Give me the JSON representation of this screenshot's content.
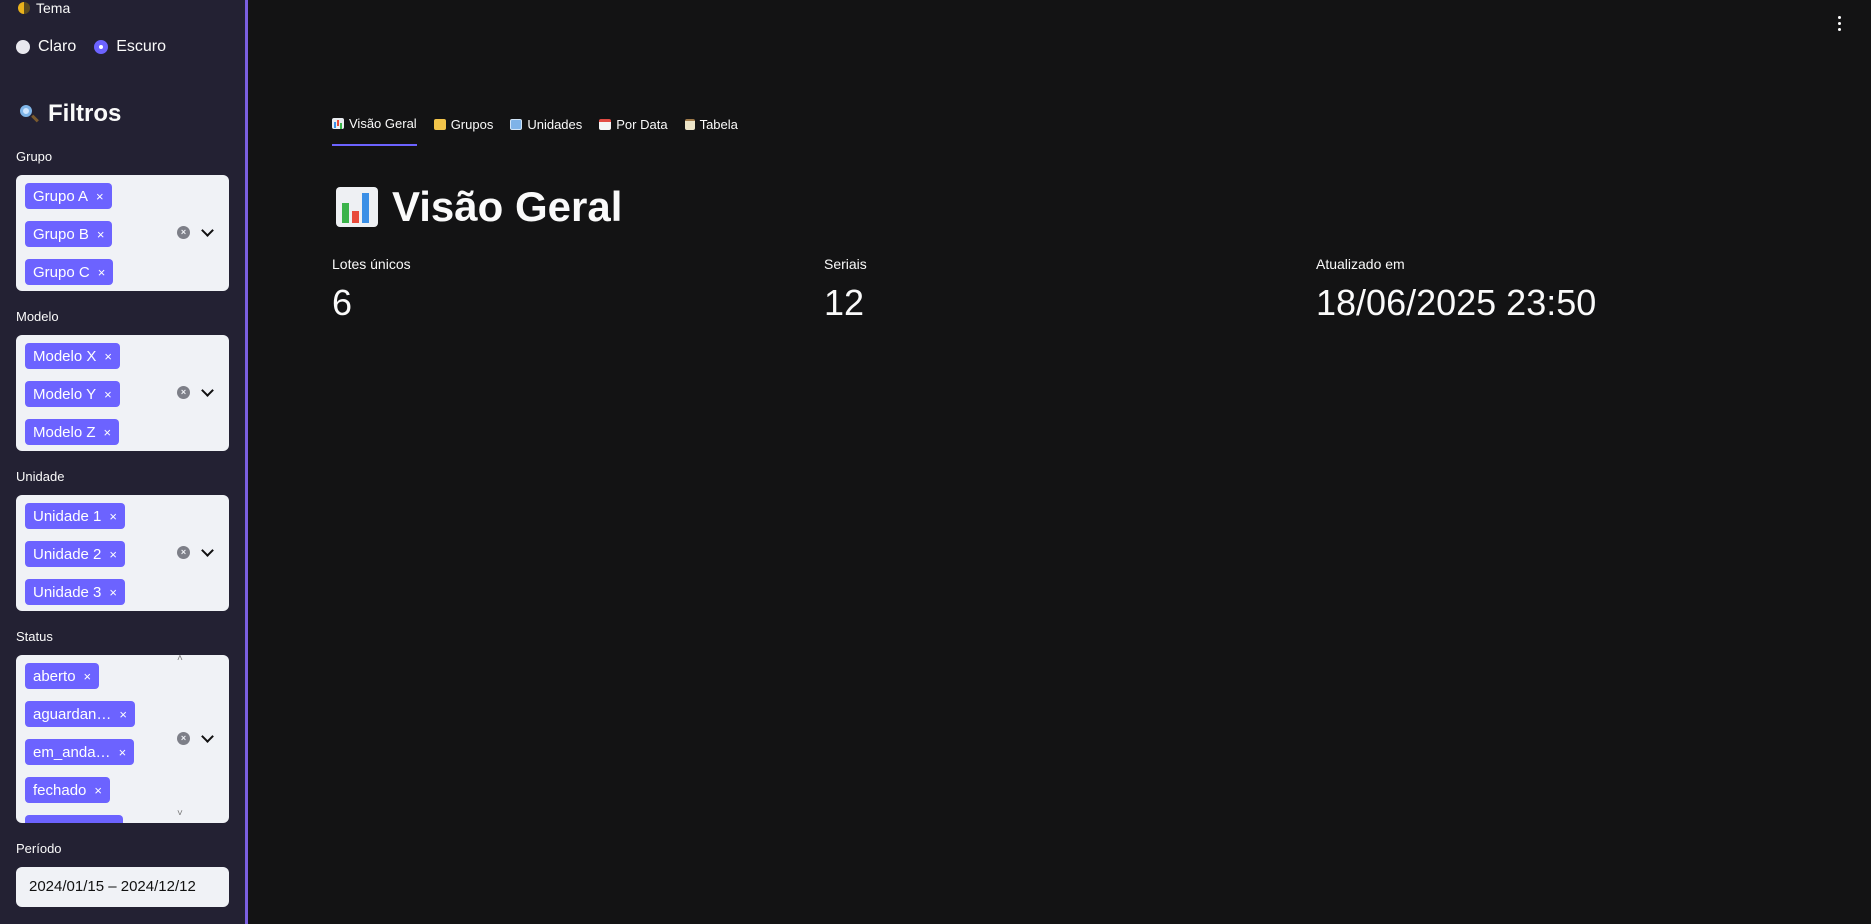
{
  "sidebar": {
    "theme_label": "Tema",
    "theme_options": [
      "Claro",
      "Escuro"
    ],
    "theme_selected": "Escuro",
    "filters_title": "Filtros",
    "filters": {
      "grupo": {
        "label": "Grupo",
        "tags": [
          "Grupo A",
          "Grupo B",
          "Grupo C"
        ]
      },
      "modelo": {
        "label": "Modelo",
        "tags": [
          "Modelo X",
          "Modelo Y",
          "Modelo Z"
        ]
      },
      "unidade": {
        "label": "Unidade",
        "tags": [
          "Unidade 1",
          "Unidade 2",
          "Unidade 3"
        ]
      },
      "status": {
        "label": "Status",
        "tags": [
          "aberto",
          "aguardan…",
          "em_anda…",
          "fechado"
        ]
      }
    },
    "periodo": {
      "label": "Período",
      "value": "2024/01/15 – 2024/12/12"
    }
  },
  "tabs": [
    {
      "icon": "bar-chart-icon",
      "label": "Visão Geral",
      "active": true
    },
    {
      "icon": "folder-icon",
      "label": "Grupos",
      "active": false
    },
    {
      "icon": "building-icon",
      "label": "Unidades",
      "active": false
    },
    {
      "icon": "calendar-icon",
      "label": "Por Data",
      "active": false
    },
    {
      "icon": "clipboard-icon",
      "label": "Tabela",
      "active": false
    }
  ],
  "main": {
    "title": "Visão Geral",
    "metrics": [
      {
        "label": "Lotes únicos",
        "value": "6"
      },
      {
        "label": "Seriais",
        "value": "12"
      },
      {
        "label": "Atualizado em",
        "value": "18/06/2025 23:50"
      }
    ]
  },
  "colors": {
    "accent": "#6c63ff",
    "sidebar_bg": "#232133",
    "main_bg": "#131314",
    "sidebar_border": "#7b5fe0"
  },
  "tag_remove_glyph": "×"
}
